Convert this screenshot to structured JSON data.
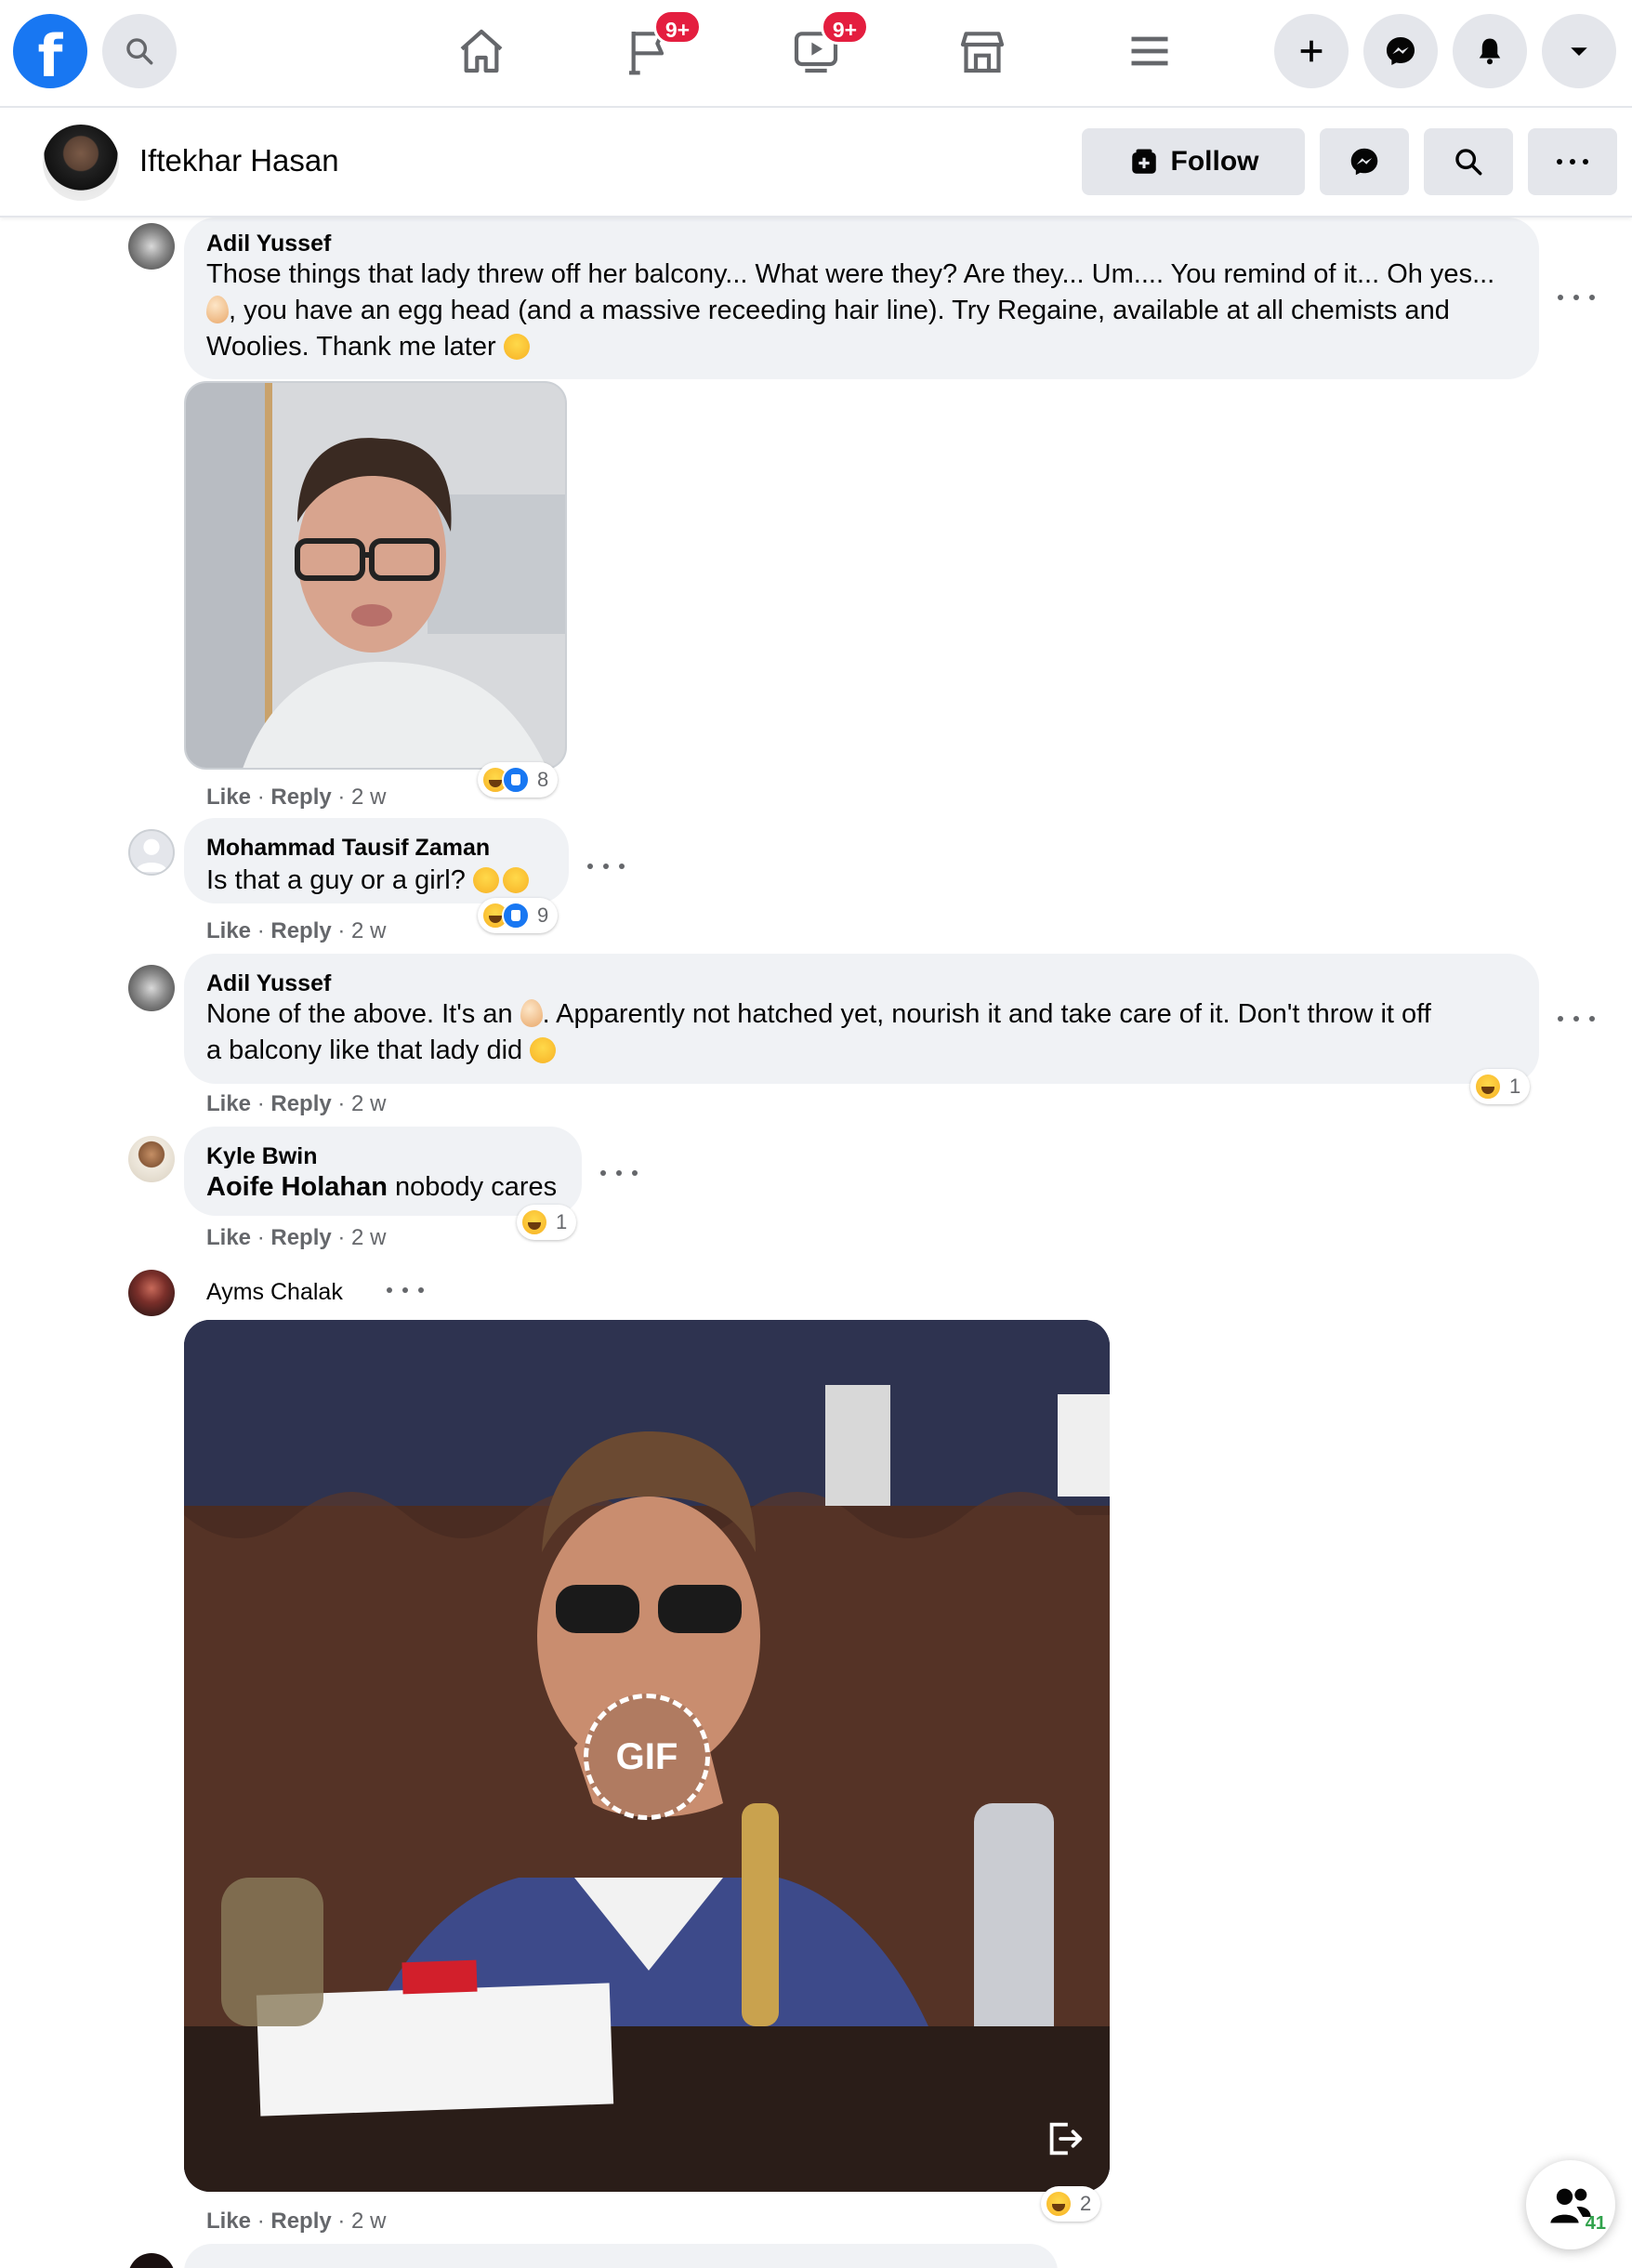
{
  "header": {
    "notification_badges": [
      "9+",
      "9+"
    ]
  },
  "profile": {
    "name": "Iftekhar Hasan",
    "follow_label": "Follow"
  },
  "comments": [
    {
      "author": "Adil Yussef",
      "text_line1": "Those things that lady threw off her balcony... What were they? Are they... Um.... You remind of it... Oh yes...",
      "text_line2": ", you have an egg head (and a massive receeding hair line). Try Regaine, available at all chemists and",
      "text_line3": "Woolies. Thank me later",
      "like": "Like",
      "reply": "Reply",
      "age": "2 w",
      "reactions_count": "8"
    },
    {
      "author": "Mohammad Tausif Zaman",
      "text": "Is that a guy or a girl?",
      "like": "Like",
      "reply": "Reply",
      "age": "2 w",
      "reactions_count": "9"
    },
    {
      "author": "Adil Yussef",
      "text_part1": "None of the above. It's an",
      "text_part2": ". Apparently not hatched yet, nourish it and take care of it. Don't throw it off",
      "text_line2": "a balcony like that lady did",
      "like": "Like",
      "reply": "Reply",
      "age": "2 w",
      "reactions_count": "1"
    },
    {
      "author": "Kyle Bwin",
      "mention": "Aoife Holahan",
      "text": "nobody cares",
      "like": "Like",
      "reply": "Reply",
      "age": "2 w",
      "reactions_count": "1"
    },
    {
      "author": "Ayms Chalak",
      "gif_label": "GIF",
      "like": "Like",
      "reply": "Reply",
      "age": "2 w",
      "reactions_count": "2"
    }
  ],
  "contacts": {
    "count": "41"
  },
  "colors": {
    "brand": "#1877f2",
    "badge": "#e41e3f",
    "bubble": "#f0f2f5",
    "meta": "#65676b",
    "online": "#31a24c"
  },
  "icons": [
    "facebook-logo",
    "search-icon",
    "home-icon",
    "flag-icon",
    "video-icon",
    "marketplace-icon",
    "menu-icon",
    "plus-icon",
    "messenger-icon",
    "bell-icon",
    "caret-down-icon",
    "more-icon",
    "gif-icon",
    "share-icon",
    "contacts-icon"
  ]
}
